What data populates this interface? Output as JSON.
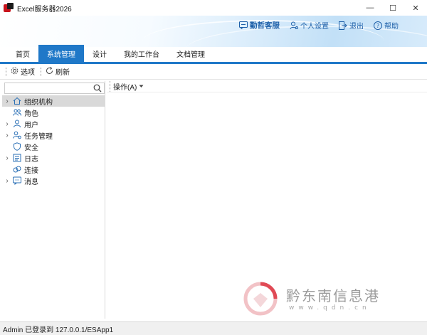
{
  "window": {
    "title": "Excel服务器2026",
    "controls": {
      "minimize": "—",
      "maximize": "☐",
      "close": "✕"
    }
  },
  "banner": {
    "links": [
      {
        "label": "勤哲客服",
        "icon": "chat-icon"
      },
      {
        "label": "个人设置",
        "icon": "person-settings-icon"
      },
      {
        "label": "退出",
        "icon": "exit-icon"
      },
      {
        "label": "帮助",
        "icon": "help-icon"
      }
    ]
  },
  "tabs": [
    {
      "label": "首页",
      "active": false
    },
    {
      "label": "系统管理",
      "active": true
    },
    {
      "label": "设计",
      "active": false
    },
    {
      "label": "我的工作台",
      "active": false
    },
    {
      "label": "文档管理",
      "active": false
    }
  ],
  "toolbar": {
    "options_label": "选项",
    "refresh_label": "刷新"
  },
  "search": {
    "value": "",
    "placeholder": ""
  },
  "tree": [
    {
      "label": "组织机构",
      "icon": "home-icon",
      "expandable": true,
      "selected": true
    },
    {
      "label": "角色",
      "icon": "roles-icon",
      "expandable": false,
      "selected": false
    },
    {
      "label": "用户",
      "icon": "user-icon",
      "expandable": true,
      "selected": false
    },
    {
      "label": "任务管理",
      "icon": "task-icon",
      "expandable": true,
      "selected": false
    },
    {
      "label": "安全",
      "icon": "shield-icon",
      "expandable": false,
      "selected": false
    },
    {
      "label": "日志",
      "icon": "log-icon",
      "expandable": true,
      "selected": false
    },
    {
      "label": "连接",
      "icon": "link-icon",
      "expandable": false,
      "selected": false
    },
    {
      "label": "消息",
      "icon": "message-icon",
      "expandable": true,
      "selected": false
    }
  ],
  "ops": {
    "label": "操作(A)"
  },
  "watermark": {
    "text": "黔东南信息港",
    "sub": "www.qdn.cn"
  },
  "status": {
    "text": "Admin 已登录到 127.0.0.1/ESApp1"
  },
  "colors": {
    "accent": "#1f78c8",
    "link": "#1d5fa8",
    "logo_red": "#c9141c"
  }
}
